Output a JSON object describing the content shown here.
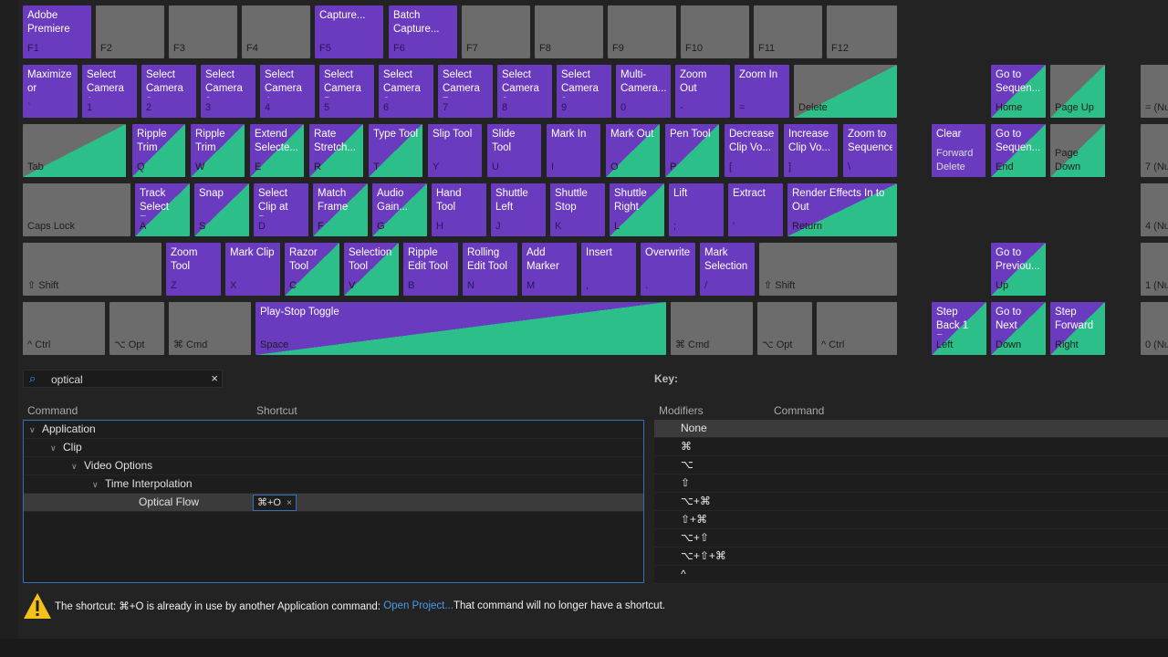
{
  "colors": {
    "application": "#6a3bbf",
    "panel": "#2cbf8a",
    "unassigned": "#6c6c6c",
    "selection": "#3a6fb8",
    "link": "#4a9be8"
  },
  "keyboard": {
    "rows": [
      {
        "keys": [
          {
            "cmd": "Adobe Premiere",
            "key": "F1",
            "type": "a"
          },
          {
            "cmd": "",
            "key": "F2",
            "type": "n"
          },
          {
            "cmd": "",
            "key": "F3",
            "type": "n"
          },
          {
            "cmd": "",
            "key": "F4",
            "type": "n"
          },
          {
            "cmd": "Capture...",
            "key": "F5",
            "type": "a"
          },
          {
            "cmd": "Batch Capture...",
            "key": "F6",
            "type": "a"
          },
          {
            "cmd": "",
            "key": "F7",
            "type": "n"
          },
          {
            "cmd": "",
            "key": "F8",
            "type": "n"
          },
          {
            "cmd": "",
            "key": "F9",
            "type": "n"
          },
          {
            "cmd": "",
            "key": "F10",
            "type": "n"
          },
          {
            "cmd": "",
            "key": "F11",
            "type": "n"
          },
          {
            "cmd": "",
            "key": "F12",
            "type": "n"
          }
        ]
      },
      {
        "keys": [
          {
            "cmd": "Maximize or",
            "key": "`",
            "type": "a"
          },
          {
            "cmd": "Select Camera 1",
            "key": "1",
            "type": "a"
          },
          {
            "cmd": "Select Camera 2",
            "key": "2",
            "type": "a"
          },
          {
            "cmd": "Select Camera 3",
            "key": "3",
            "type": "a"
          },
          {
            "cmd": "Select Camera 4",
            "key": "4",
            "type": "a"
          },
          {
            "cmd": "Select Camera 5",
            "key": "5",
            "type": "a"
          },
          {
            "cmd": "Select Camera 6",
            "key": "6",
            "type": "a"
          },
          {
            "cmd": "Select Camera 7",
            "key": "7",
            "type": "a"
          },
          {
            "cmd": "Select Camera 8",
            "key": "8",
            "type": "a"
          },
          {
            "cmd": "Select Camera 9",
            "key": "9",
            "type": "a"
          },
          {
            "cmd": "Multi-Camera...",
            "key": "0",
            "type": "a"
          },
          {
            "cmd": "Zoom Out",
            "key": "-",
            "type": "a"
          },
          {
            "cmd": "Zoom In",
            "key": "=",
            "type": "a"
          },
          {
            "cmd": "",
            "key": "Delete",
            "type": "p"
          },
          {
            "cmd": "Go to Sequen...",
            "key": "Home",
            "type": "b"
          },
          {
            "cmd": "",
            "key": "Page Up",
            "type": "p"
          },
          {
            "cmd": "",
            "key": "= (Num",
            "type": "n"
          }
        ]
      },
      {
        "keys": [
          {
            "cmd": "",
            "key": "Tab",
            "type": "p"
          },
          {
            "cmd": "Ripple Trim",
            "key": "Q",
            "type": "b"
          },
          {
            "cmd": "Ripple Trim",
            "key": "W",
            "type": "b"
          },
          {
            "cmd": "Extend Selecte...",
            "key": "E",
            "type": "b"
          },
          {
            "cmd": "Rate Stretch...",
            "key": "R",
            "type": "b"
          },
          {
            "cmd": "Type Tool",
            "key": "T",
            "type": "b"
          },
          {
            "cmd": "Slip Tool",
            "key": "Y",
            "type": "a"
          },
          {
            "cmd": "Slide Tool",
            "key": "U",
            "type": "a"
          },
          {
            "cmd": "Mark In",
            "key": "I",
            "type": "a"
          },
          {
            "cmd": "Mark Out",
            "key": "O",
            "type": "b"
          },
          {
            "cmd": "Pen Tool",
            "key": "P",
            "type": "b"
          },
          {
            "cmd": "Decrease Clip Vo...",
            "key": "[",
            "type": "a"
          },
          {
            "cmd": "Increase Clip Vo...",
            "key": "]",
            "type": "a"
          },
          {
            "cmd": "Zoom to Sequence",
            "key": "\\",
            "type": "a"
          },
          {
            "cmd": "Clear",
            "key": "Forward Delete",
            "type": "a"
          },
          {
            "cmd": "Go to Sequen...",
            "key": "End",
            "type": "b"
          },
          {
            "cmd": "",
            "key": "Page Down",
            "type": "p"
          },
          {
            "cmd": "",
            "key": "7 (Nu",
            "type": "n"
          }
        ]
      },
      {
        "keys": [
          {
            "cmd": "",
            "key": "Caps Lock",
            "type": "n"
          },
          {
            "cmd": "Track Select F...",
            "key": "A",
            "type": "b"
          },
          {
            "cmd": "Snap",
            "key": "S",
            "type": "b"
          },
          {
            "cmd": "Select Clip at P...",
            "key": "D",
            "type": "a"
          },
          {
            "cmd": "Match Frame",
            "key": "F",
            "type": "b"
          },
          {
            "cmd": "Audio Gain...",
            "key": "G",
            "type": "b"
          },
          {
            "cmd": "Hand Tool",
            "key": "H",
            "type": "a"
          },
          {
            "cmd": "Shuttle Left",
            "key": "J",
            "type": "a"
          },
          {
            "cmd": "Shuttle Stop",
            "key": "K",
            "type": "a"
          },
          {
            "cmd": "Shuttle Right",
            "key": "L",
            "type": "b"
          },
          {
            "cmd": "Lift",
            "key": ";",
            "type": "a"
          },
          {
            "cmd": "Extract",
            "key": "'",
            "type": "a"
          },
          {
            "cmd": "Render Effects In to Out",
            "key": "Return",
            "type": "b"
          },
          {
            "cmd": "",
            "key": "4 (Nu",
            "type": "n"
          }
        ]
      },
      {
        "keys": [
          {
            "cmd": "",
            "key": "⇧ Shift",
            "type": "n"
          },
          {
            "cmd": "Zoom Tool",
            "key": "Z",
            "type": "a"
          },
          {
            "cmd": "Mark Clip",
            "key": "X",
            "type": "a"
          },
          {
            "cmd": "Razor Tool",
            "key": "C",
            "type": "b"
          },
          {
            "cmd": "Selection Tool",
            "key": "V",
            "type": "b"
          },
          {
            "cmd": "Ripple Edit Tool",
            "key": "B",
            "type": "a"
          },
          {
            "cmd": "Rolling Edit Tool",
            "key": "N",
            "type": "a"
          },
          {
            "cmd": "Add Marker",
            "key": "M",
            "type": "a"
          },
          {
            "cmd": "Insert",
            "key": ",",
            "type": "a"
          },
          {
            "cmd": "Overwrite",
            "key": ".",
            "type": "a"
          },
          {
            "cmd": "Mark Selection",
            "key": "/",
            "type": "a"
          },
          {
            "cmd": "",
            "key": "⇧ Shift",
            "type": "n"
          },
          {
            "cmd": "Go to Previou...",
            "key": "Up",
            "type": "b"
          },
          {
            "cmd": "",
            "key": "1 (Nu",
            "type": "n"
          }
        ]
      },
      {
        "keys": [
          {
            "cmd": "",
            "key": "^ Ctrl",
            "type": "n"
          },
          {
            "cmd": "",
            "key": "⌥ Opt",
            "type": "n"
          },
          {
            "cmd": "",
            "key": "⌘ Cmd",
            "type": "n"
          },
          {
            "cmd": "Play-Stop Toggle",
            "key": "Space",
            "type": "b"
          },
          {
            "cmd": "",
            "key": "⌘ Cmd",
            "type": "n"
          },
          {
            "cmd": "",
            "key": "⌥ Opt",
            "type": "n"
          },
          {
            "cmd": "",
            "key": "^ Ctrl",
            "type": "n"
          },
          {
            "cmd": "Step Back 1 Frame",
            "key": "Left",
            "type": "b"
          },
          {
            "cmd": "Go to Next",
            "key": "Down",
            "type": "b"
          },
          {
            "cmd": "Step Forward",
            "key": "Right",
            "type": "b"
          },
          {
            "cmd": "",
            "key": "0 (Nu",
            "type": "n"
          }
        ]
      }
    ]
  },
  "search": {
    "value": "optical",
    "icon": "search-icon",
    "clear_icon": "×"
  },
  "command_list": {
    "col_command": "Command",
    "col_shortcut": "Shortcut",
    "rows": [
      {
        "label": "Application",
        "level": 0,
        "expanded": true
      },
      {
        "label": "Clip",
        "level": 1,
        "expanded": true
      },
      {
        "label": "Video Options",
        "level": 2,
        "expanded": true
      },
      {
        "label": "Time Interpolation",
        "level": 3,
        "expanded": true
      },
      {
        "label": "Optical Flow",
        "level": 4,
        "shortcut": "⌘+O",
        "selected": true
      }
    ]
  },
  "key_panel": {
    "label": "Key:",
    "col_modifiers": "Modifiers",
    "col_command": "Command",
    "rows": [
      "None",
      "⌘",
      "⌥",
      "⇧",
      "⌥+⌘",
      "⇧+⌘",
      "⌥+⇧",
      "⌥+⇧+⌘",
      "^",
      "^+⌘"
    ]
  },
  "warning": {
    "text_before": "The shortcut: ⌘+O is already in use by another Application command: ",
    "link": "Open Project...",
    "text_after": " That command will no longer have a shortcut."
  }
}
